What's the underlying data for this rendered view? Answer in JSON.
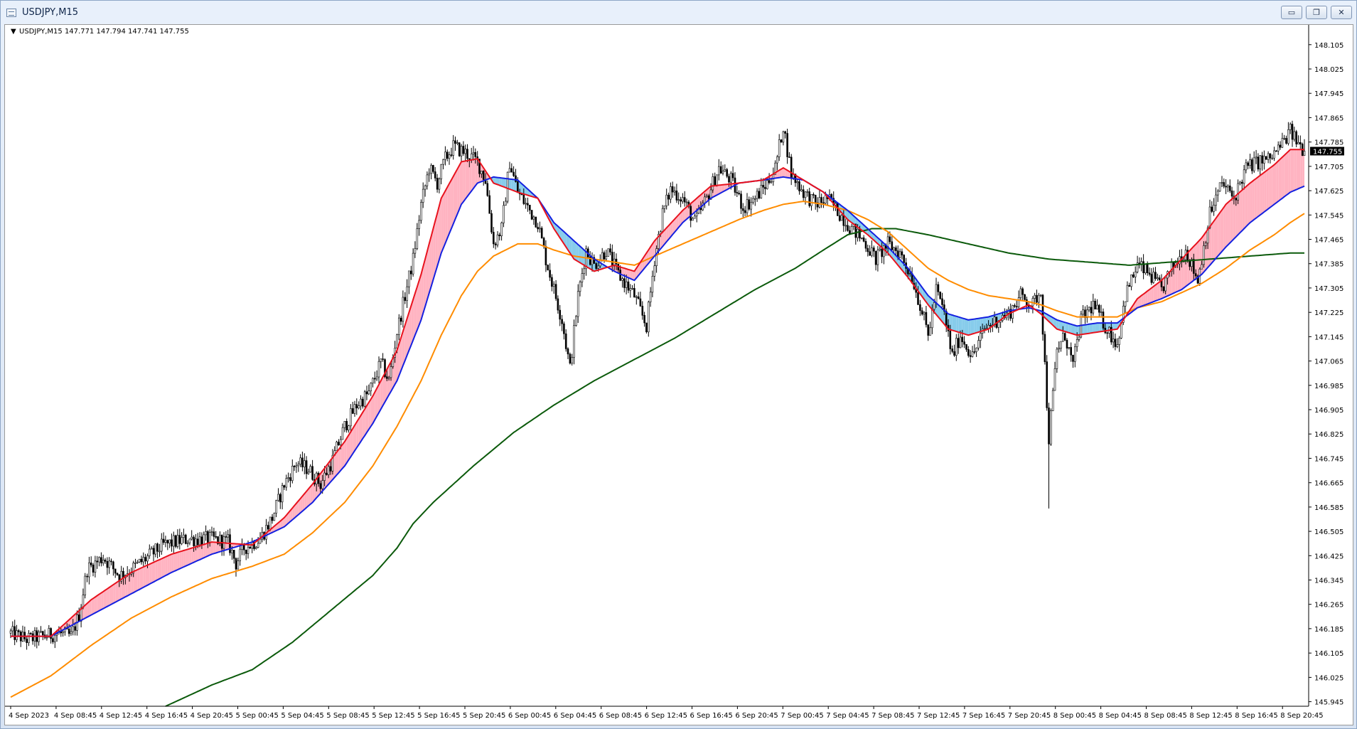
{
  "window": {
    "title": "USDJPY,M15",
    "minimize_glyph": "▭",
    "restore_glyph": "❐",
    "close_glyph": "✕"
  },
  "chart_info": {
    "text": "USDJPY,M15  147.771 147.794 147.741 147.755",
    "collapse_glyph": "▼"
  },
  "price_label": "147.755",
  "colors": {
    "candle": "#000000",
    "ema_fast": "#e8121d",
    "ema_mid": "#1420e0",
    "ema_slow": "#ff8c00",
    "sma_long": "#0b5a0b",
    "cloud_bull": "#ffb3c1",
    "cloud_bear": "#87cceb",
    "price_box": "#000000",
    "price_text": "#ffffff"
  },
  "chart_data": {
    "type": "candlestick",
    "symbol": "USDJPY",
    "timeframe": "M15",
    "ylim": [
      145.93,
      148.17
    ],
    "y_ticks": [
      "148.105",
      "148.025",
      "147.945",
      "147.865",
      "147.785",
      "147.705",
      "147.625",
      "147.545",
      "147.465",
      "147.385",
      "147.305",
      "147.225",
      "147.145",
      "147.065",
      "146.985",
      "146.905",
      "146.825",
      "146.745",
      "146.665",
      "146.585",
      "146.505",
      "146.425",
      "146.345",
      "146.265",
      "146.185",
      "146.105",
      "146.025",
      "145.945"
    ],
    "x_ticks": [
      "4 Sep 2023",
      "4 Sep 08:45",
      "4 Sep 12:45",
      "4 Sep 16:45",
      "4 Sep 20:45",
      "5 Sep 00:45",
      "5 Sep 04:45",
      "5 Sep 08:45",
      "5 Sep 12:45",
      "5 Sep 16:45",
      "5 Sep 20:45",
      "6 Sep 00:45",
      "6 Sep 04:45",
      "6 Sep 08:45",
      "6 Sep 12:45",
      "6 Sep 16:45",
      "6 Sep 20:45",
      "7 Sep 00:45",
      "7 Sep 04:45",
      "7 Sep 08:45",
      "7 Sep 12:45",
      "7 Sep 16:45",
      "7 Sep 20:45",
      "8 Sep 00:45",
      "8 Sep 04:45",
      "8 Sep 08:45",
      "8 Sep 12:45",
      "8 Sep 16:45",
      "8 Sep 20:45"
    ],
    "last_price": 147.755,
    "ohlc_last": {
      "open": 147.771,
      "high": 147.794,
      "low": 147.741,
      "close": 147.755
    },
    "price_path": [
      [
        0,
        146.17
      ],
      [
        8,
        146.15
      ],
      [
        16,
        146.16
      ],
      [
        24,
        146.17
      ],
      [
        30,
        146.16
      ],
      [
        34,
        146.23
      ],
      [
        38,
        146.38
      ],
      [
        46,
        146.42
      ],
      [
        54,
        146.36
      ],
      [
        60,
        146.38
      ],
      [
        68,
        146.42
      ],
      [
        76,
        146.46
      ],
      [
        88,
        146.48
      ],
      [
        100,
        146.48
      ],
      [
        108,
        146.47
      ],
      [
        112,
        146.4
      ],
      [
        116,
        146.45
      ],
      [
        124,
        146.48
      ],
      [
        130,
        146.55
      ],
      [
        136,
        146.66
      ],
      [
        142,
        146.73
      ],
      [
        148,
        146.71
      ],
      [
        154,
        146.66
      ],
      [
        160,
        146.74
      ],
      [
        166,
        146.85
      ],
      [
        172,
        146.92
      ],
      [
        178,
        146.96
      ],
      [
        184,
        147.06
      ],
      [
        188,
        147.0
      ],
      [
        192,
        147.16
      ],
      [
        196,
        147.28
      ],
      [
        200,
        147.4
      ],
      [
        204,
        147.58
      ],
      [
        208,
        147.7
      ],
      [
        212,
        147.65
      ],
      [
        216,
        147.73
      ],
      [
        220,
        147.77
      ],
      [
        226,
        147.75
      ],
      [
        232,
        147.72
      ],
      [
        236,
        147.66
      ],
      [
        240,
        147.45
      ],
      [
        244,
        147.5
      ],
      [
        248,
        147.72
      ],
      [
        252,
        147.62
      ],
      [
        256,
        147.58
      ],
      [
        262,
        147.52
      ],
      [
        266,
        147.4
      ],
      [
        270,
        147.3
      ],
      [
        274,
        147.2
      ],
      [
        278,
        147.04
      ],
      [
        282,
        147.28
      ],
      [
        286,
        147.43
      ],
      [
        290,
        147.38
      ],
      [
        296,
        147.43
      ],
      [
        302,
        147.35
      ],
      [
        310,
        147.28
      ],
      [
        316,
        147.18
      ],
      [
        320,
        147.4
      ],
      [
        324,
        147.55
      ],
      [
        328,
        147.63
      ],
      [
        334,
        147.6
      ],
      [
        340,
        147.52
      ],
      [
        346,
        147.6
      ],
      [
        352,
        147.7
      ],
      [
        358,
        147.66
      ],
      [
        364,
        147.57
      ],
      [
        370,
        147.6
      ],
      [
        376,
        147.65
      ],
      [
        380,
        147.7
      ],
      [
        384,
        147.84
      ],
      [
        388,
        147.68
      ],
      [
        394,
        147.62
      ],
      [
        400,
        147.58
      ],
      [
        406,
        147.6
      ],
      [
        412,
        147.55
      ],
      [
        418,
        147.5
      ],
      [
        424,
        147.46
      ],
      [
        430,
        147.4
      ],
      [
        436,
        147.45
      ],
      [
        442,
        147.42
      ],
      [
        448,
        147.34
      ],
      [
        452,
        147.25
      ],
      [
        456,
        147.15
      ],
      [
        460,
        147.3
      ],
      [
        464,
        147.22
      ],
      [
        468,
        147.08
      ],
      [
        472,
        147.15
      ],
      [
        478,
        147.08
      ],
      [
        484,
        147.17
      ],
      [
        490,
        147.2
      ],
      [
        496,
        147.22
      ],
      [
        502,
        147.28
      ],
      [
        508,
        147.25
      ],
      [
        512,
        147.3
      ],
      [
        514,
        147.05
      ],
      [
        516,
        146.81
      ],
      [
        520,
        147.1
      ],
      [
        524,
        147.15
      ],
      [
        528,
        147.05
      ],
      [
        532,
        147.2
      ],
      [
        538,
        147.25
      ],
      [
        544,
        147.18
      ],
      [
        550,
        147.12
      ],
      [
        554,
        147.28
      ],
      [
        560,
        147.38
      ],
      [
        566,
        147.35
      ],
      [
        572,
        147.3
      ],
      [
        578,
        147.38
      ],
      [
        584,
        147.43
      ],
      [
        590,
        147.33
      ],
      [
        596,
        147.55
      ],
      [
        602,
        147.65
      ],
      [
        608,
        147.6
      ],
      [
        614,
        147.7
      ],
      [
        620,
        147.72
      ],
      [
        626,
        147.73
      ],
      [
        632,
        147.78
      ],
      [
        636,
        147.82
      ],
      [
        640,
        147.78
      ],
      [
        643,
        147.755
      ]
    ],
    "series": [
      {
        "key": "ema_fast",
        "points": [
          [
            0,
            146.16
          ],
          [
            20,
            146.16
          ],
          [
            40,
            146.28
          ],
          [
            60,
            146.37
          ],
          [
            80,
            146.43
          ],
          [
            100,
            146.47
          ],
          [
            120,
            146.46
          ],
          [
            136,
            146.55
          ],
          [
            150,
            146.66
          ],
          [
            166,
            146.8
          ],
          [
            180,
            146.95
          ],
          [
            192,
            147.1
          ],
          [
            204,
            147.35
          ],
          [
            214,
            147.6
          ],
          [
            224,
            147.72
          ],
          [
            232,
            147.73
          ],
          [
            240,
            147.65
          ],
          [
            252,
            147.62
          ],
          [
            262,
            147.6
          ],
          [
            270,
            147.5
          ],
          [
            280,
            147.4
          ],
          [
            290,
            147.36
          ],
          [
            300,
            147.38
          ],
          [
            310,
            147.36
          ],
          [
            320,
            147.46
          ],
          [
            334,
            147.56
          ],
          [
            348,
            147.64
          ],
          [
            362,
            147.65
          ],
          [
            374,
            147.66
          ],
          [
            384,
            147.7
          ],
          [
            394,
            147.66
          ],
          [
            404,
            147.62
          ],
          [
            416,
            147.53
          ],
          [
            426,
            147.48
          ],
          [
            436,
            147.42
          ],
          [
            446,
            147.34
          ],
          [
            456,
            147.25
          ],
          [
            466,
            147.17
          ],
          [
            476,
            147.15
          ],
          [
            486,
            147.17
          ],
          [
            496,
            147.22
          ],
          [
            506,
            147.25
          ],
          [
            512,
            147.22
          ],
          [
            520,
            147.17
          ],
          [
            530,
            147.15
          ],
          [
            540,
            147.16
          ],
          [
            550,
            147.17
          ],
          [
            560,
            147.27
          ],
          [
            572,
            147.33
          ],
          [
            582,
            147.4
          ],
          [
            592,
            147.47
          ],
          [
            604,
            147.58
          ],
          [
            616,
            147.65
          ],
          [
            628,
            147.71
          ],
          [
            636,
            147.76
          ],
          [
            643,
            147.76
          ]
        ]
      },
      {
        "key": "ema_mid",
        "points": [
          [
            0,
            146.16
          ],
          [
            20,
            146.16
          ],
          [
            40,
            146.23
          ],
          [
            60,
            146.3
          ],
          [
            80,
            146.37
          ],
          [
            100,
            146.43
          ],
          [
            120,
            146.47
          ],
          [
            136,
            146.52
          ],
          [
            150,
            146.6
          ],
          [
            166,
            146.72
          ],
          [
            180,
            146.86
          ],
          [
            192,
            147.0
          ],
          [
            204,
            147.2
          ],
          [
            214,
            147.42
          ],
          [
            224,
            147.58
          ],
          [
            232,
            147.65
          ],
          [
            240,
            147.67
          ],
          [
            252,
            147.66
          ],
          [
            262,
            147.6
          ],
          [
            270,
            147.52
          ],
          [
            280,
            147.46
          ],
          [
            290,
            147.4
          ],
          [
            300,
            147.36
          ],
          [
            310,
            147.33
          ],
          [
            320,
            147.41
          ],
          [
            334,
            147.52
          ],
          [
            348,
            147.6
          ],
          [
            362,
            147.65
          ],
          [
            374,
            147.66
          ],
          [
            384,
            147.67
          ],
          [
            394,
            147.66
          ],
          [
            404,
            147.62
          ],
          [
            416,
            147.56
          ],
          [
            426,
            147.5
          ],
          [
            436,
            147.44
          ],
          [
            446,
            147.37
          ],
          [
            456,
            147.28
          ],
          [
            466,
            147.22
          ],
          [
            476,
            147.2
          ],
          [
            486,
            147.21
          ],
          [
            496,
            147.23
          ],
          [
            506,
            147.24
          ],
          [
            512,
            147.23
          ],
          [
            520,
            147.2
          ],
          [
            530,
            147.18
          ],
          [
            540,
            147.19
          ],
          [
            550,
            147.19
          ],
          [
            560,
            147.24
          ],
          [
            572,
            147.27
          ],
          [
            582,
            147.3
          ],
          [
            592,
            147.35
          ],
          [
            604,
            147.44
          ],
          [
            616,
            147.52
          ],
          [
            628,
            147.58
          ],
          [
            636,
            147.62
          ],
          [
            643,
            147.64
          ]
        ]
      },
      {
        "key": "ema_slow",
        "points": [
          [
            0,
            145.96
          ],
          [
            20,
            146.03
          ],
          [
            40,
            146.13
          ],
          [
            60,
            146.22
          ],
          [
            80,
            146.29
          ],
          [
            100,
            146.35
          ],
          [
            120,
            146.39
          ],
          [
            136,
            146.43
          ],
          [
            150,
            146.5
          ],
          [
            166,
            146.6
          ],
          [
            180,
            146.72
          ],
          [
            192,
            146.85
          ],
          [
            204,
            147.0
          ],
          [
            214,
            147.15
          ],
          [
            224,
            147.28
          ],
          [
            232,
            147.36
          ],
          [
            240,
            147.41
          ],
          [
            252,
            147.45
          ],
          [
            262,
            147.45
          ],
          [
            270,
            147.43
          ],
          [
            280,
            147.41
          ],
          [
            290,
            147.4
          ],
          [
            300,
            147.39
          ],
          [
            310,
            147.38
          ],
          [
            320,
            147.41
          ],
          [
            334,
            147.45
          ],
          [
            348,
            147.49
          ],
          [
            362,
            147.53
          ],
          [
            374,
            147.56
          ],
          [
            384,
            147.58
          ],
          [
            394,
            147.59
          ],
          [
            404,
            147.58
          ],
          [
            416,
            147.56
          ],
          [
            426,
            147.53
          ],
          [
            436,
            147.49
          ],
          [
            446,
            147.43
          ],
          [
            456,
            147.37
          ],
          [
            466,
            147.33
          ],
          [
            476,
            147.3
          ],
          [
            486,
            147.28
          ],
          [
            496,
            147.27
          ],
          [
            506,
            147.26
          ],
          [
            512,
            147.25
          ],
          [
            520,
            147.23
          ],
          [
            530,
            147.21
          ],
          [
            540,
            147.21
          ],
          [
            550,
            147.21
          ],
          [
            560,
            147.24
          ],
          [
            572,
            147.26
          ],
          [
            582,
            147.29
          ],
          [
            592,
            147.32
          ],
          [
            604,
            147.37
          ],
          [
            616,
            147.43
          ],
          [
            628,
            147.48
          ],
          [
            636,
            147.52
          ],
          [
            643,
            147.55
          ]
        ]
      },
      {
        "key": "sma_long",
        "points": [
          [
            77,
            145.93
          ],
          [
            100,
            146.0
          ],
          [
            120,
            146.05
          ],
          [
            140,
            146.14
          ],
          [
            160,
            146.25
          ],
          [
            180,
            146.36
          ],
          [
            192,
            146.45
          ],
          [
            200,
            146.53
          ],
          [
            210,
            146.6
          ],
          [
            230,
            146.72
          ],
          [
            250,
            146.83
          ],
          [
            270,
            146.92
          ],
          [
            290,
            147.0
          ],
          [
            310,
            147.07
          ],
          [
            330,
            147.14
          ],
          [
            350,
            147.22
          ],
          [
            370,
            147.3
          ],
          [
            390,
            147.37
          ],
          [
            404,
            147.43
          ],
          [
            416,
            147.48
          ],
          [
            428,
            147.5
          ],
          [
            440,
            147.5
          ],
          [
            456,
            147.48
          ],
          [
            476,
            147.45
          ],
          [
            496,
            147.42
          ],
          [
            516,
            147.4
          ],
          [
            536,
            147.39
          ],
          [
            556,
            147.38
          ],
          [
            576,
            147.39
          ],
          [
            596,
            147.4
          ],
          [
            616,
            147.41
          ],
          [
            636,
            147.42
          ],
          [
            643,
            147.42
          ]
        ]
      }
    ]
  }
}
